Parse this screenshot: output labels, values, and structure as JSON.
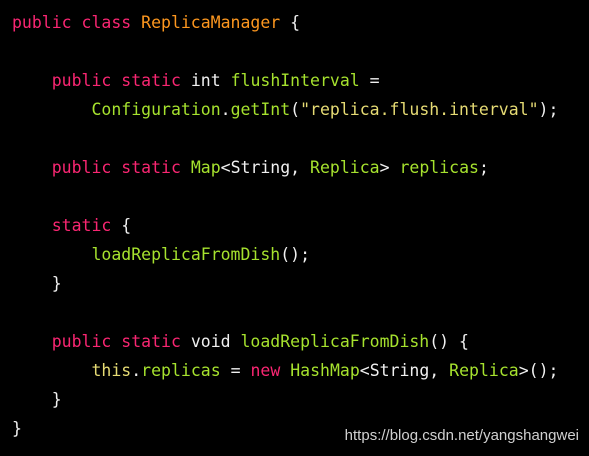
{
  "code_lines": [
    {
      "tokens": [
        {
          "t": "public class ",
          "c": "kw"
        },
        {
          "t": "ReplicaManager",
          "c": "cls"
        },
        {
          "t": " {",
          "c": "punc"
        }
      ]
    },
    {
      "tokens": []
    },
    {
      "tokens": [
        {
          "t": "    ",
          "c": "punc"
        },
        {
          "t": "public static ",
          "c": "kw"
        },
        {
          "t": "int ",
          "c": "ident"
        },
        {
          "t": "flushInterval",
          "c": "type"
        },
        {
          "t": " =",
          "c": "punc"
        }
      ]
    },
    {
      "tokens": [
        {
          "t": "        ",
          "c": "punc"
        },
        {
          "t": "Configuration",
          "c": "type"
        },
        {
          "t": ".",
          "c": "punc"
        },
        {
          "t": "getInt",
          "c": "type"
        },
        {
          "t": "(",
          "c": "punc"
        },
        {
          "t": "\"replica.flush.interval\"",
          "c": "str"
        },
        {
          "t": ");",
          "c": "punc"
        }
      ]
    },
    {
      "tokens": []
    },
    {
      "tokens": [
        {
          "t": "    ",
          "c": "punc"
        },
        {
          "t": "public static ",
          "c": "kw"
        },
        {
          "t": "Map",
          "c": "type"
        },
        {
          "t": "<String, ",
          "c": "punc"
        },
        {
          "t": "Replica",
          "c": "type"
        },
        {
          "t": "> ",
          "c": "punc"
        },
        {
          "t": "replicas",
          "c": "type"
        },
        {
          "t": ";",
          "c": "punc"
        }
      ]
    },
    {
      "tokens": []
    },
    {
      "tokens": [
        {
          "t": "    ",
          "c": "punc"
        },
        {
          "t": "static",
          "c": "kw"
        },
        {
          "t": " {",
          "c": "punc"
        }
      ]
    },
    {
      "tokens": [
        {
          "t": "        ",
          "c": "punc"
        },
        {
          "t": "loadReplicaFromDish",
          "c": "type"
        },
        {
          "t": "();",
          "c": "punc"
        }
      ]
    },
    {
      "tokens": [
        {
          "t": "    }",
          "c": "punc"
        }
      ]
    },
    {
      "tokens": []
    },
    {
      "tokens": [
        {
          "t": "    ",
          "c": "punc"
        },
        {
          "t": "public static ",
          "c": "kw"
        },
        {
          "t": "void ",
          "c": "ident"
        },
        {
          "t": "loadReplicaFromDish",
          "c": "type"
        },
        {
          "t": "() {",
          "c": "punc"
        }
      ]
    },
    {
      "tokens": [
        {
          "t": "        ",
          "c": "punc"
        },
        {
          "t": "this",
          "c": "kw-this"
        },
        {
          "t": ".",
          "c": "punc"
        },
        {
          "t": "replicas",
          "c": "type"
        },
        {
          "t": " = ",
          "c": "punc"
        },
        {
          "t": "new ",
          "c": "kw"
        },
        {
          "t": "HashMap",
          "c": "type"
        },
        {
          "t": "<String, ",
          "c": "punc"
        },
        {
          "t": "Replica",
          "c": "type"
        },
        {
          "t": ">();",
          "c": "punc"
        }
      ]
    },
    {
      "tokens": [
        {
          "t": "    }",
          "c": "punc"
        }
      ]
    },
    {
      "tokens": [
        {
          "t": "}",
          "c": "punc"
        }
      ]
    }
  ],
  "watermark": "https://blog.csdn.net/yangshangwei"
}
